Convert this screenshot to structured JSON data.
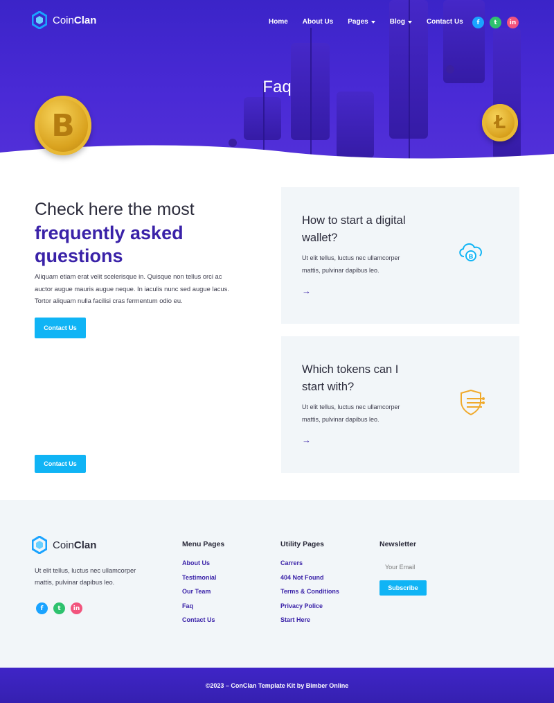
{
  "brand": {
    "name_light": "Coin",
    "name_bold": "Clan"
  },
  "nav": {
    "items": [
      {
        "label": "Home",
        "dropdown": false
      },
      {
        "label": "About Us",
        "dropdown": false
      },
      {
        "label": "Pages",
        "dropdown": true
      },
      {
        "label": "Blog",
        "dropdown": true
      },
      {
        "label": "Contact Us",
        "dropdown": false
      }
    ]
  },
  "social": {
    "facebook": "f",
    "twitter": "t",
    "linkedin": "in"
  },
  "hero": {
    "title": "Faq"
  },
  "faq": {
    "heading_light": "Check here the most",
    "heading_bold": "frequently asked questions",
    "paragraph": "Aliquam etiam erat velit scelerisque in. Quisque non tellus orci ac auctor augue mauris augue neque. In iaculis nunc sed augue lacus. Tortor aliquam nulla facilisi cras fermentum odio eu.",
    "contact_button": "Contact Us",
    "contact_button_2": "Contact Us",
    "cards": [
      {
        "title": "How to start a digital wallet?",
        "text": "Ut elit tellus, luctus nec ullamcorper mattis, pulvinar dapibus leo.",
        "arrow": "→",
        "icon": "cloud-bitcoin-icon"
      },
      {
        "title": "Which tokens can I start with?",
        "text": "Ut elit tellus, luctus nec ullamcorper mattis, pulvinar dapibus leo.",
        "arrow": "→",
        "icon": "shield-circuit-icon"
      }
    ]
  },
  "footer": {
    "about": "Ut elit tellus, luctus nec ullamcorper mattis, pulvinar dapibus leo.",
    "menu_pages": {
      "title": "Menu Pages",
      "links": [
        "About Us",
        "Testimonial",
        "Our Team",
        "Faq",
        "Contact Us"
      ]
    },
    "utility_pages": {
      "title": "Utility Pages",
      "links": [
        "Carrers",
        "404 Not Found",
        "Terms & Conditions",
        "Privacy Police",
        "Start Here"
      ]
    },
    "newsletter": {
      "title": "Newsletter",
      "placeholder": "Your Email",
      "button": "Subscribe"
    },
    "copyright": "©2023 – ConClan Template Kit by Bimber Online"
  },
  "colors": {
    "hero_bg": "#3b24c8",
    "accent_purple": "#3a22a8",
    "button_blue": "#10b4f5",
    "card_bg": "#f2f6f9",
    "facebook": "#1aa3ff",
    "twitter": "#2ec26e",
    "linkedin": "#f2547d"
  }
}
